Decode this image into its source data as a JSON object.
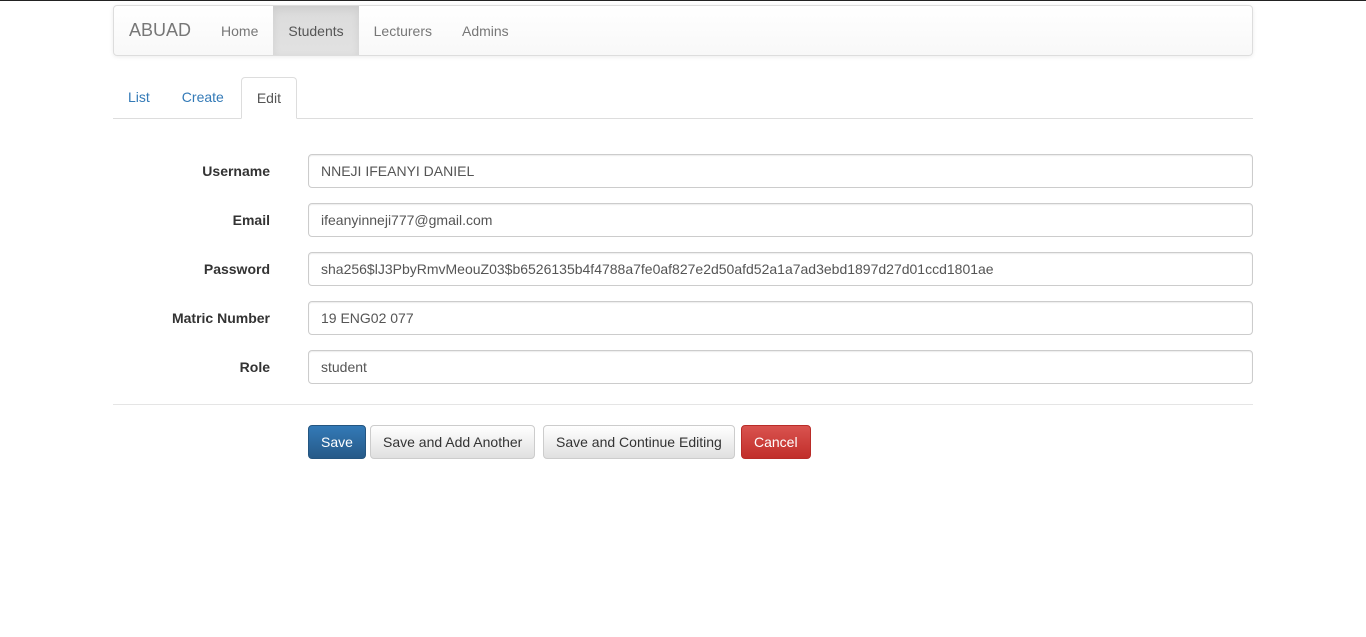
{
  "navbar": {
    "brand": "ABUAD",
    "items": [
      {
        "label": "Home"
      },
      {
        "label": "Students"
      },
      {
        "label": "Lecturers"
      },
      {
        "label": "Admins"
      }
    ],
    "active": "Students"
  },
  "tabs": {
    "items": [
      {
        "label": "List"
      },
      {
        "label": "Create"
      },
      {
        "label": "Edit"
      }
    ],
    "active": "Edit"
  },
  "form": {
    "fields": [
      {
        "label": "Username",
        "value": "NNEJI IFEANYI DANIEL"
      },
      {
        "label": "Email",
        "value": "ifeanyinneji777@gmail.com"
      },
      {
        "label": "Password",
        "value": "sha256$lJ3PbyRmvMeouZ03$b6526135b4f4788a7fe0af827e2d50afd52a1a7ad3ebd1897d27d01ccd1801ae"
      },
      {
        "label": "Matric Number",
        "value": "19 ENG02 077"
      },
      {
        "label": "Role",
        "value": "student"
      }
    ]
  },
  "actions": {
    "save": "Save",
    "save_add_another": "Save and Add Another",
    "save_continue": "Save and Continue Editing",
    "cancel": "Cancel"
  },
  "colors": {
    "primary": "#337ab7",
    "danger": "#d9534f",
    "link": "#337ab7"
  }
}
